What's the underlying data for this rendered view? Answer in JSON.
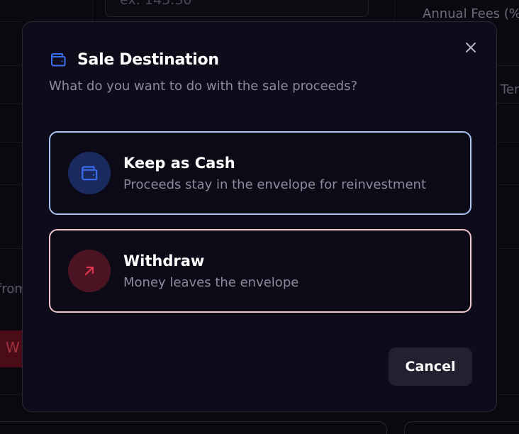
{
  "background": {
    "input_placeholder": "ex: 145.30",
    "annual_fees_label": "Annual Fees (%",
    "ter_label": "Ter",
    "from_label": "from",
    "red_button_label": "W"
  },
  "modal": {
    "title": "Sale Destination",
    "subtitle": "What do you want to do with the sale proceeds?",
    "title_icon": "wallet-icon",
    "close_icon": "close-icon",
    "options": [
      {
        "title": "Keep as Cash",
        "description": "Proceeds stay in the envelope for reinvestment",
        "icon": "wallet-icon",
        "accent": "#3b6ef0",
        "border": "#a9c3f3"
      },
      {
        "title": "Withdraw",
        "description": "Money leaves the envelope",
        "icon": "arrow-up-right-icon",
        "accent": "#e0344f",
        "border": "#f0c6cd"
      }
    ],
    "cancel_label": "Cancel"
  }
}
